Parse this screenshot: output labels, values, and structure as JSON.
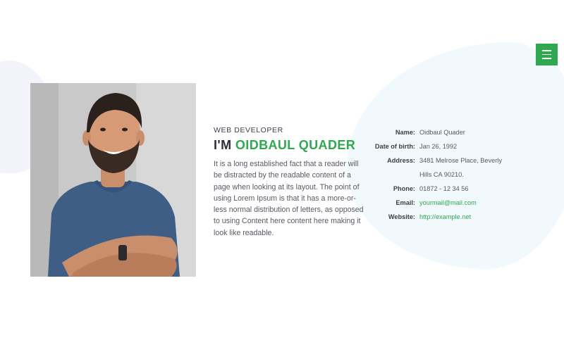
{
  "menu": {
    "icon": "hamburger-icon"
  },
  "photo": {
    "icon": "portrait-photo"
  },
  "intro": {
    "subtitle": "WEB DEVELOPER",
    "heading_prefix": "I'M ",
    "heading_name": "OIDBAUL QUADER",
    "bio": "It is a long established fact that a reader will be distracted by the readable content of a page when looking at its layout. The point of using Lorem Ipsum is that it has a more-or-less normal distribution of letters, as opposed to using Content here content here making it look like readable."
  },
  "info": {
    "name_label": "Name:",
    "name_value": "Oidbaul Quader",
    "dob_label": "Date of birth:",
    "dob_value": "Jan 26, 1992",
    "address_label": "Address:",
    "address_line1": "3481 Melrose Place, Beverly",
    "address_line2": "Hills CA 90210.",
    "phone_label": "Phone:",
    "phone_value": "01872 - 12 34 56",
    "email_label": "Email:",
    "email_value": "yourmail@mail.com",
    "website_label": "Website:",
    "website_value": "http://example.net"
  },
  "colors": {
    "accent": "#2fa84f",
    "heading": "#2b2f3a",
    "text": "#555a64",
    "blob_right": "#f1f9fd",
    "blob_left": "#f3f4fb"
  }
}
